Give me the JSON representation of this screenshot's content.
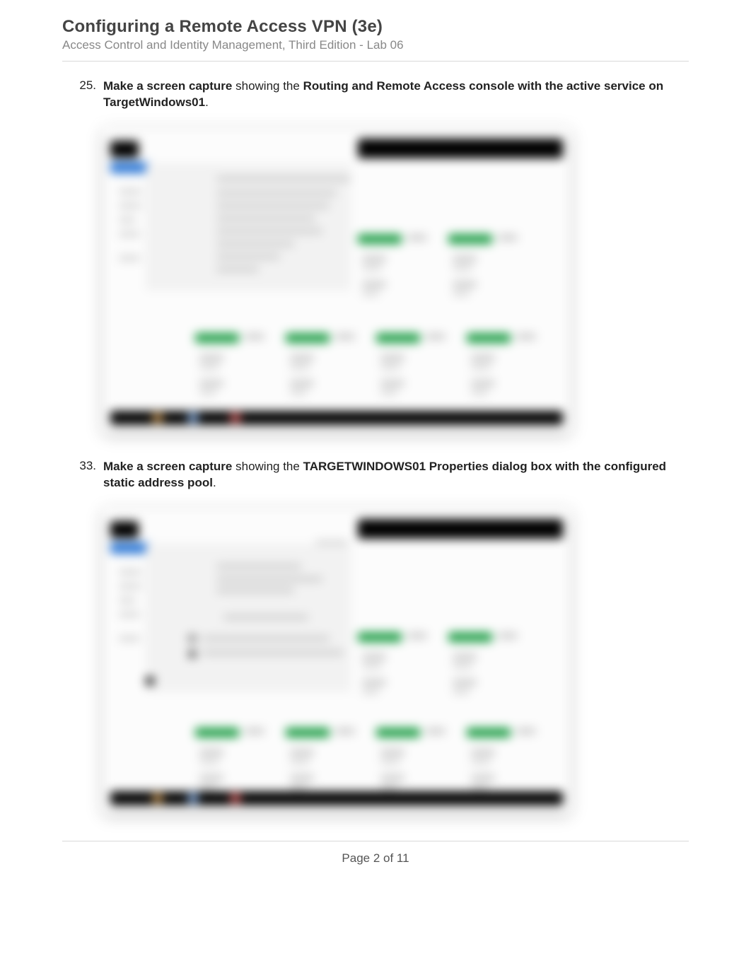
{
  "header": {
    "title": "Configuring a Remote Access VPN (3e)",
    "subtitle": "Access Control and Identity Management, Third Edition - Lab 06"
  },
  "items": [
    {
      "number": "25.",
      "lead_bold": "Make a screen capture",
      "mid_plain": " showing the ",
      "tail_bold": "Routing and Remote Access console with the active service on TargetWindows01",
      "end": "."
    },
    {
      "number": "33.",
      "lead_bold": "Make a screen capture",
      "mid_plain": " showing the ",
      "tail_bold": "TARGETWINDOWS01 Properties dialog box with the configured static address pool",
      "end": "."
    }
  ],
  "footer": {
    "page_label": "Page 2 of 11"
  },
  "colors": {
    "accent_blue": "#2d78d6",
    "accent_green": "#1e9e46"
  }
}
